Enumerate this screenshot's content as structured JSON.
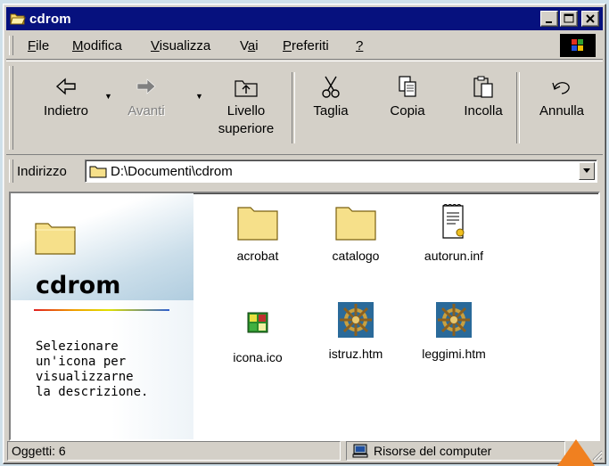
{
  "window": {
    "title": "cdrom"
  },
  "menu": {
    "items": [
      {
        "label": "File",
        "ul": "F",
        "rest": "ile"
      },
      {
        "label": "Modifica",
        "ul": "M",
        "rest": "odifica"
      },
      {
        "label": "Visualizza",
        "ul": "V",
        "rest": "isualizza"
      },
      {
        "label": "Vai",
        "pre": "V",
        "ul": "a",
        "rest": "i"
      },
      {
        "label": "Preferiti",
        "ul": "P",
        "rest": "referiti"
      },
      {
        "label": "?",
        "ul": "?",
        "rest": ""
      }
    ]
  },
  "toolbar": {
    "back_label": "Indietro",
    "forward_label": "Avanti",
    "up_label_1": "Livello",
    "up_label_2": "superiore",
    "cut_label": "Taglia",
    "copy_label": "Copia",
    "paste_label": "Incolla",
    "undo_label": "Annulla"
  },
  "address": {
    "label": "Indirizzo",
    "value": "D:\\Documenti\\cdrom"
  },
  "leftpanel": {
    "folder_name": "cdrom",
    "description": "Selezionare\nun'icona per\nvisualizzarne\nla descrizione."
  },
  "files": [
    {
      "name": "acrobat",
      "icon": "folder-icon"
    },
    {
      "name": "catalogo",
      "icon": "folder-icon"
    },
    {
      "name": "autorun.inf",
      "icon": "settings-file-icon"
    },
    {
      "name": "icona.ico",
      "icon": "ico-file-icon"
    },
    {
      "name": "istruz.htm",
      "icon": "ship-wheel-icon"
    },
    {
      "name": "leggimi.htm",
      "icon": "ship-wheel-icon"
    }
  ],
  "status": {
    "objects": "Oggetti: 6",
    "location": "Risorse del computer"
  },
  "colors": {
    "titlebar": "#06117e",
    "chrome": "#d4d0c8",
    "folder": "#f6e08a"
  }
}
